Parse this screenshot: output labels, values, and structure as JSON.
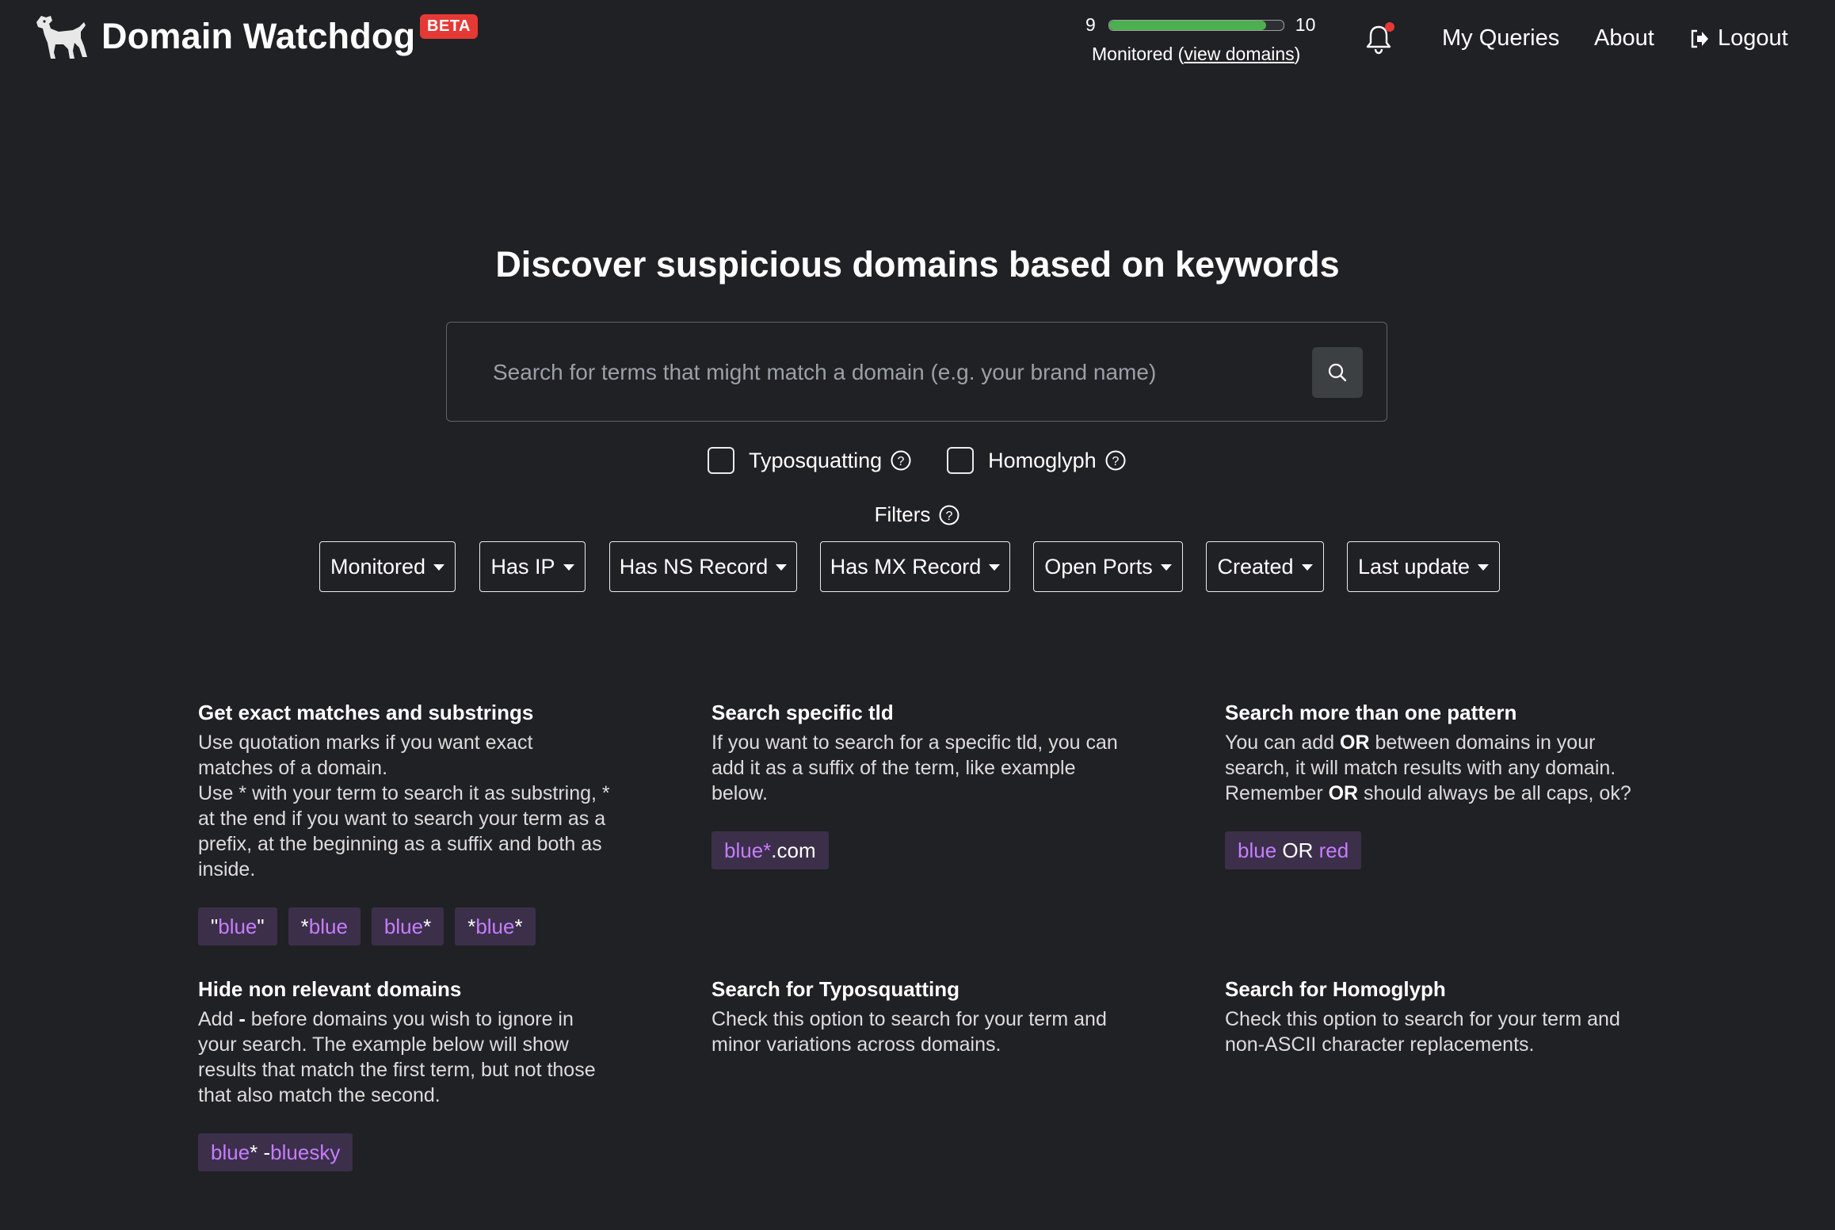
{
  "header": {
    "brand": "Domain Watchdog",
    "badge": "BETA",
    "quota": {
      "used": "9",
      "limit": "10",
      "fraction": 0.9,
      "caption_prefix": "Monitored (",
      "caption_link": "view domains",
      "caption_suffix": ")"
    },
    "nav": {
      "queries": "My Queries",
      "about": "About",
      "logout": "Logout"
    },
    "icons": {
      "logo": "dog-icon",
      "notifications": "bell-icon",
      "logout": "logout-icon"
    }
  },
  "main": {
    "title": "Discover suspicious domains based on keywords",
    "search": {
      "placeholder": "Search for terms that might match a domain (e.g. your brand name)",
      "value": ""
    },
    "options": {
      "typosquatting": "Typosquatting",
      "homoglyph": "Homoglyph"
    },
    "filters_label": "Filters",
    "filters": [
      "Monitored",
      "Has IP",
      "Has NS Record",
      "Has MX Record",
      "Open Ports",
      "Created",
      "Last update"
    ]
  },
  "help": {
    "exact": {
      "title": "Get exact matches and substrings",
      "line1": "Use quotation marks if you want exact matches of a domain.",
      "line2": "Use * with your term to search it as substring, * at the end if you want to search your term as a prefix, at the beginning as a suffix and both as inside.",
      "chips": [
        {
          "a": "\"",
          "b": "blue",
          "c": "\""
        },
        {
          "a": "*",
          "b": "blue",
          "c": ""
        },
        {
          "a": "",
          "b": "blue",
          "c": "*"
        },
        {
          "a": "*",
          "b": "blue",
          "c": "*"
        }
      ]
    },
    "tld": {
      "title": "Search specific tld",
      "text": "If you want to search for a specific tld, you can add it as a suffix of the term, like example below.",
      "chip": {
        "a": "blue",
        "b": "*",
        "c": ".com"
      }
    },
    "multi": {
      "title": "Search more than one pattern",
      "t1": "You can add ",
      "or1": "OR",
      "t2": " between domains in your search, it will match results with any domain. Remember ",
      "or2": "OR",
      "t3": " should always be all caps, ok?",
      "chip": {
        "a": "blue",
        "b": " OR ",
        "c": "red"
      }
    },
    "hide": {
      "title": "Hide non relevant domains",
      "t1": "Add ",
      "minus": "-",
      "t2": " before domains you wish to ignore in your search. The example below will show results that match the first term, but not those that also match the second.",
      "chip": {
        "a": "blue",
        "b": "* -",
        "c": "bluesky"
      }
    },
    "typo": {
      "title": "Search for Typosquatting",
      "text": "Check this option to search for your term and minor variations across domains."
    },
    "homo": {
      "title": "Search for Homoglyph",
      "text": "Check this option to search for your term and non-ASCII character replacements."
    }
  }
}
